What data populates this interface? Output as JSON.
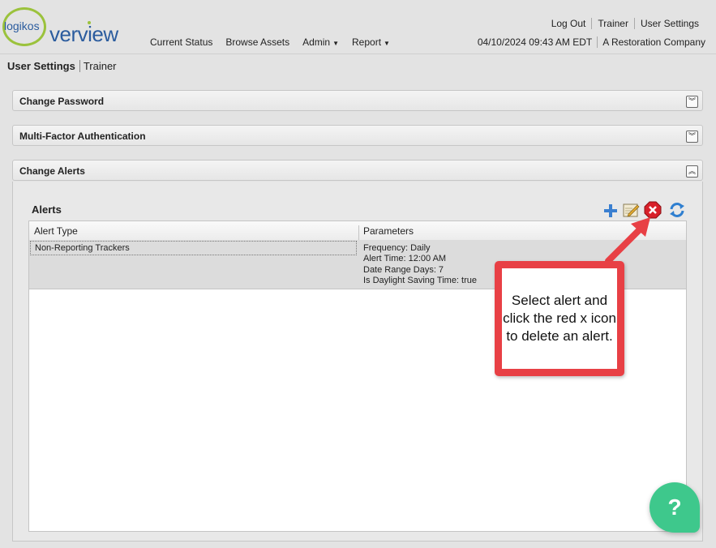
{
  "logo": {
    "small": "logikos",
    "big": "verview"
  },
  "nav": {
    "items": [
      "Current Status",
      "Browse Assets",
      "Admin",
      "Report"
    ]
  },
  "top_links": [
    "Log Out",
    "Trainer",
    "User Settings"
  ],
  "info": {
    "datetime": "04/10/2024 09:43 AM EDT",
    "company": "A Restoration Company"
  },
  "breadcrumb": {
    "current": "User Settings",
    "user": "Trainer"
  },
  "panels": {
    "change_password": "Change Password",
    "mfa": "Multi-Factor Authentication",
    "change_alerts": "Change Alerts"
  },
  "alerts": {
    "title": "Alerts",
    "columns": [
      "Alert Type",
      "Parameters"
    ],
    "rows": [
      {
        "type": "Non-Reporting Trackers",
        "params": [
          "Frequency: Daily",
          "Alert Time: 12:00 AM",
          "Date Range Days: 7",
          "Is Daylight Saving Time: true"
        ]
      }
    ]
  },
  "callout": {
    "text": "Select alert and click the red x icon to delete an alert."
  },
  "help": {
    "label": "?"
  },
  "colors": {
    "accent": "#2b5c9e",
    "logo_green": "#9bc23c",
    "callout_red": "#e84045",
    "help_green": "#3ec88c"
  }
}
